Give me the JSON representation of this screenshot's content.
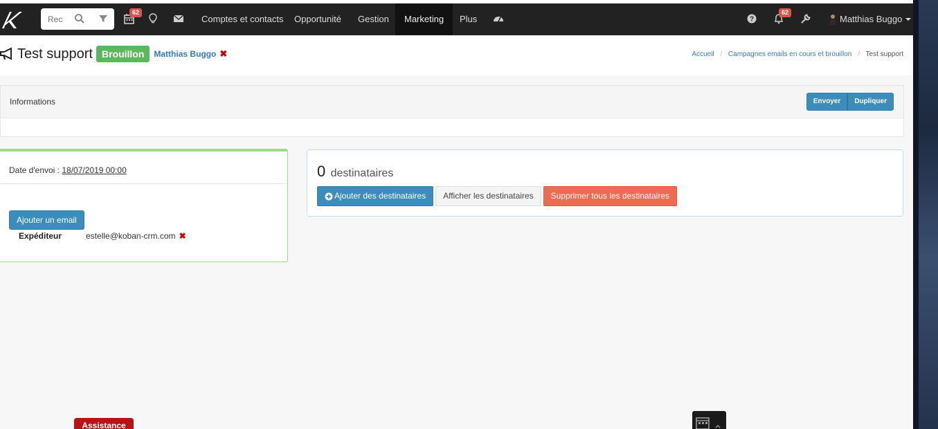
{
  "navbar": {
    "search_placeholder": "Rec",
    "calendar_badge": "62",
    "notifications_badge": "62",
    "links": [
      {
        "label": "Comptes et contacts"
      },
      {
        "label": "Opportunité"
      },
      {
        "label": "Gestion"
      },
      {
        "label": "Marketing"
      },
      {
        "label": "Plus"
      }
    ],
    "user_name": "Matthias Buggo"
  },
  "header": {
    "title": "Test support",
    "status": "Brouillon",
    "owner": "Matthias Buggo",
    "remove_symbol": "✖",
    "breadcrumb": [
      "Accueil",
      "Campagnes emails en cours et brouillon",
      "Test support"
    ],
    "breadcrumb_sep": "/"
  },
  "info_panel": {
    "title": "Informations",
    "send_label": "Envoyer",
    "duplicate_label": "Dupliquer"
  },
  "left_box": {
    "date_label": "Date d'envoi :",
    "date_value": "18/07/2019 00:00",
    "add_email_label": "Ajouter un email",
    "sender_label": "Expéditeur",
    "sender_value": "estelle@koban-crm.com",
    "remove_symbol": "✖"
  },
  "recipients": {
    "count": "0",
    "count_label": "destinataires",
    "add_label": "Ajouter des destinataires",
    "show_label": "Afficher les destinataires",
    "delete_all_label": "Supprimer tous les destinataires"
  },
  "footer": {
    "assistance_label": "Assistance"
  },
  "colors": {
    "navbar_bg": "#222222",
    "primary": "#3c8dbc",
    "success": "#5cb85c",
    "danger": "#ef6a52",
    "badge": "#d9534f",
    "assistance": "#b81414"
  }
}
